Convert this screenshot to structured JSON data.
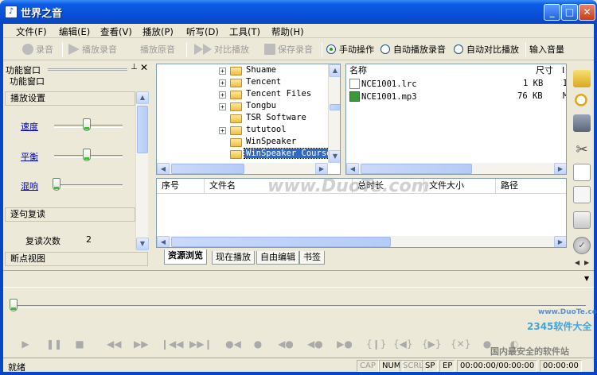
{
  "window": {
    "title": "世界之音",
    "app_icon": "speaker-icon"
  },
  "menu": [
    {
      "label": "文件(F)"
    },
    {
      "label": "编辑(E)"
    },
    {
      "label": "查看(V)"
    },
    {
      "label": "播放(P)"
    },
    {
      "label": "听写(D)"
    },
    {
      "label": "工具(T)"
    },
    {
      "label": "帮助(H)"
    }
  ],
  "toolbar": {
    "record": "录音",
    "play_recording": "播放录音",
    "play_original": "播放原音",
    "compare_play": "对比播放",
    "save_recording": "保存录音",
    "manual": "手动操作",
    "auto_record": "自动播放录音",
    "auto_compare": "自动对比播放",
    "input_volume": "输入音量"
  },
  "left_panel": {
    "header": "功能窗口",
    "section_title": "功能窗口",
    "playback_settings": "播放设置",
    "speed": {
      "label": "速度",
      "level": 0.5
    },
    "balance": {
      "label": "平衡",
      "level": 0.5
    },
    "mix": {
      "label": "混响",
      "level": 0.0
    },
    "repeat_section": "逐句复读",
    "repeat_count_label": "复读次数",
    "repeat_count": "2",
    "breakpoint_view": "断点视图"
  },
  "tree": [
    {
      "name": "Shuame",
      "expandable": true
    },
    {
      "name": "Tencent",
      "expandable": true
    },
    {
      "name": "Tencent Files",
      "expandable": true
    },
    {
      "name": "Tongbu",
      "expandable": true
    },
    {
      "name": "TSR Software",
      "expandable": false
    },
    {
      "name": "tututool",
      "expandable": true
    },
    {
      "name": "WinSpeaker",
      "expandable": false
    },
    {
      "name": "WinSpeaker Courses",
      "expandable": false,
      "selected": true
    }
  ],
  "file_list": {
    "col_name": "名称",
    "col_size": "尺寸",
    "col_type_partial": "I",
    "files": [
      {
        "name": "NCE1001.lrc",
        "size": "1 KB",
        "type": "I",
        "icon": "text-file-icon"
      },
      {
        "name": "NCE1001.mp3",
        "size": "76 KB",
        "type": "M",
        "icon": "mp3-file-icon"
      }
    ]
  },
  "playlist": {
    "columns": [
      "序号",
      "文件名",
      "总时长",
      "文件大小",
      "路径"
    ]
  },
  "tabs": [
    "资源浏览",
    "现在播放",
    "自由编辑",
    "书签"
  ],
  "active_tab": 0,
  "right_toolbar": [
    "open-folder-icon",
    "search-icon",
    "save-icon",
    "cut-icon",
    "copy-icon",
    "paste-icon",
    "print-icon",
    "check-icon"
  ],
  "position": {
    "level": 0.0
  },
  "status": {
    "text": "就绪",
    "cap": "CAP",
    "num": "NUM",
    "scrl": "SCRL",
    "sp": "SP",
    "ep": "EP",
    "time_range": "00:00:00/00:00:00",
    "time_cur": "00:00:00"
  },
  "watermarks": {
    "site": "www.DuoTe.com",
    "site2": "www.DuoTe.com",
    "brand": "2345软件大全",
    "slogan": "国内最安全的软件站"
  },
  "colors": {
    "titlebar": "#0a50d8",
    "selection": "#316ac5",
    "link": "#0000c0"
  }
}
